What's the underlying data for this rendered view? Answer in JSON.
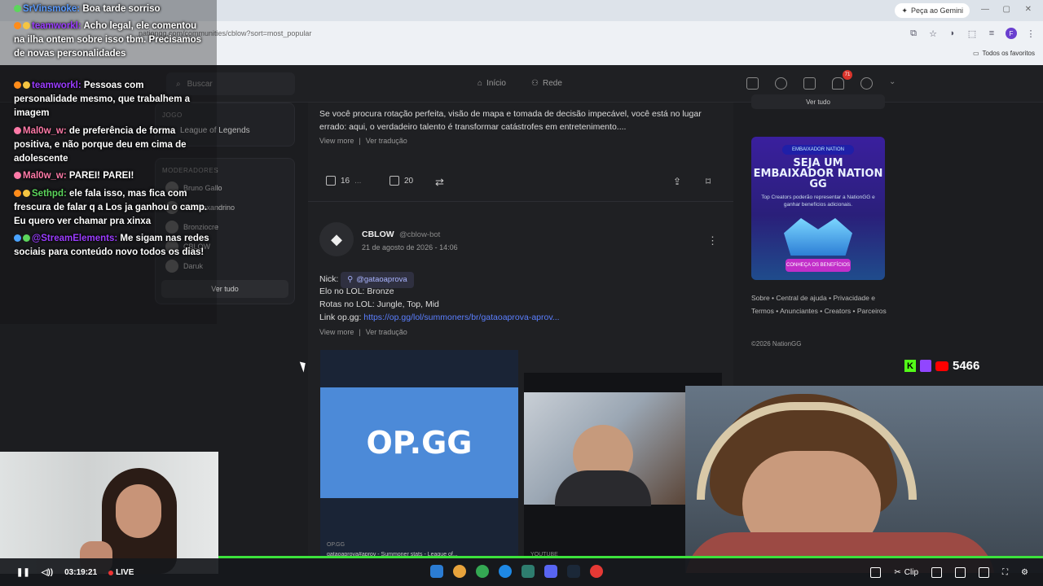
{
  "browser": {
    "url": "nationgg.com/communities/cblow?sort=most_popular",
    "gemini_label": "Peça ao Gemini",
    "favorites_label": "Todos os favoritos"
  },
  "header": {
    "search_placeholder": "Buscar",
    "nav_home": "Início",
    "nav_network": "Rede",
    "notifications_count": "71"
  },
  "sidebar": {
    "game_label": "JOGO",
    "game_name": "League of Legends",
    "moderators_label": "MODERADORES",
    "moderators": [
      "Bruno Gallo",
      "Rui Alexandrino",
      "Bronziocre",
      "CBLOW",
      "Daruk"
    ],
    "see_all": "Ver tudo"
  },
  "post1": {
    "text": "Se você procura rotação perfeita, visão de mapa e tomada de decisão impecável, você está no lugar errado: aqui, o verdadeiro talento é transformar catástrofes em entretenimento....",
    "view_more": "View more",
    "translate": "Ver tradução",
    "likes": "16",
    "comments": "20"
  },
  "post2": {
    "author": "CBLOW",
    "handle": "@cblow-bot",
    "date": "21 de agosto de 2026 - 14:06",
    "nick_label": "Nick:",
    "nick_value": "@gataoaprova",
    "elo": "Elo no LOL: Bronze",
    "roles": "Rotas no LOL: Jungle, Top, Mid",
    "opgg_label": "Link op.gg:",
    "opgg_link": "https://op.gg/lol/summoners/br/gataoaprova-aprov...",
    "view_more": "View more",
    "translate": "Ver tradução",
    "thumb1_logo": "OP.GG",
    "thumb1_source": "OP.GG",
    "thumb1_caption": "gataoaprova#aprov - Summoner stats - League of...",
    "thumb2_source": "YOUTUBE"
  },
  "promo": {
    "tag": "EMBAIXADOR NATION",
    "title": "SEJA UM EMBAIXADOR NATION GG",
    "subtitle": "Top Creators poderão representar a NationGG e ganhar benefícios adicionais.",
    "button": "CONHEÇA OS BENEFÍCIOS",
    "top_button": "Ver tudo"
  },
  "footer": {
    "links": "Sobre • Central de ajuda • Privacidade e Termos • Anunciantes • Creators • Parceiros",
    "copyright": "©2026 NationGG"
  },
  "chat": [
    {
      "user": "SrVinsmoke:",
      "msg": "Boa tarde sorriso"
    },
    {
      "user": "teamworkl:",
      "msg": "Acho legal, ele comentou na ilha ontem sobre isso tbm. Precisamos de novas personalidades"
    },
    {
      "user": "teamworkl:",
      "msg": "Pessoas com personalidade mesmo, que trabalhem a imagem"
    },
    {
      "user": "Mal0w_w:",
      "msg": "de preferência de forma positiva, e não porque deu em cima de adolescente"
    },
    {
      "user": "Mal0w_w:",
      "msg": "PAREI! PAREI!"
    },
    {
      "user": "Sethpd:",
      "msg": "ele fala isso, mas fica com frescura de falar q a Los ja ganhou o camp. Eu quero ver chamar pra xinxa"
    },
    {
      "user": "@StreamElements:",
      "msg": "Me sigam nas redes sociais para conteúdo novo todos os dias!"
    }
  ],
  "stream": {
    "viewers": "5466",
    "time": "03:19:21",
    "live": "LIVE",
    "clip": "Clip",
    "progress": 1.0
  },
  "colors": {
    "accent_green": "#3ce23c",
    "link_blue": "#5b7fff"
  }
}
